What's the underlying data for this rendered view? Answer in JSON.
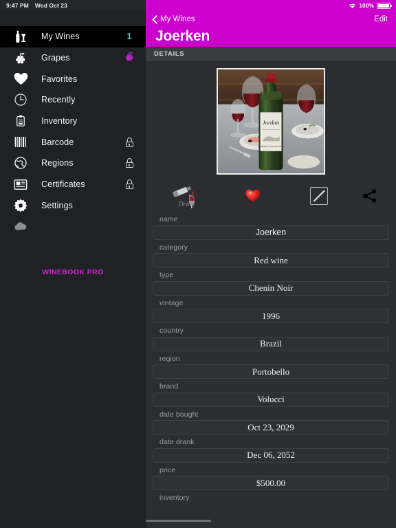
{
  "status_bar": {
    "time": "9:47 PM",
    "date": "Wed Oct 23",
    "battery_percent": "100%",
    "wifi_icon": "wifi-icon",
    "battery_icon": "battery-full-icon"
  },
  "sidebar": {
    "pro_label": "WINEBOOK PRO",
    "items": [
      {
        "label": "My Wines",
        "icon": "wine-bottle-glass-icon",
        "selected": true,
        "badge": "1",
        "lock": false,
        "grapes": false
      },
      {
        "label": "Grapes",
        "icon": "grapes-icon",
        "selected": false,
        "badge": "",
        "lock": false,
        "grapes": true
      },
      {
        "label": "Favorites",
        "icon": "heart-icon",
        "selected": false,
        "badge": "",
        "lock": false,
        "grapes": false
      },
      {
        "label": "Recently",
        "icon": "clock-icon",
        "selected": false,
        "badge": "",
        "lock": false,
        "grapes": false
      },
      {
        "label": "Inventory",
        "icon": "clipboard-icon",
        "selected": false,
        "badge": "",
        "lock": false,
        "grapes": false
      },
      {
        "label": "Barcode",
        "icon": "barcode-icon",
        "selected": false,
        "badge": "",
        "lock": true,
        "grapes": false
      },
      {
        "label": "Regions",
        "icon": "globe-icon",
        "selected": false,
        "badge": "",
        "lock": true,
        "grapes": false
      },
      {
        "label": "Certificates",
        "icon": "certificate-icon",
        "selected": false,
        "badge": "",
        "lock": true,
        "grapes": false
      },
      {
        "label": "Settings",
        "icon": "gear-icon",
        "selected": false,
        "badge": "",
        "lock": false,
        "grapes": false
      },
      {
        "label": "",
        "icon": "cloud-icon",
        "selected": false,
        "badge": "",
        "lock": false,
        "grapes": false
      }
    ]
  },
  "detail": {
    "back_label": "My Wines",
    "edit_label": "Edit",
    "title": "Joerken",
    "section_label": "DETAILS",
    "photo_alt": "wine-bottle-photo",
    "actions": [
      {
        "name": "drink-button",
        "icon": "drink-pour-icon",
        "caption": "Drink"
      },
      {
        "name": "favorite-button",
        "icon": "heart-icon",
        "caption": ""
      },
      {
        "name": "rating-button",
        "icon": "empty-rating-icon",
        "caption": ""
      },
      {
        "name": "share-button",
        "icon": "share-icon",
        "caption": ""
      }
    ],
    "fields": [
      {
        "label": "name",
        "value": "Joerken",
        "serif": false
      },
      {
        "label": "category",
        "value": "Red wine",
        "serif": true
      },
      {
        "label": "type",
        "value": "Chenin Noir",
        "serif": true
      },
      {
        "label": "vintage",
        "value": "1996",
        "serif": true
      },
      {
        "label": "country",
        "value": "Brazil",
        "serif": true
      },
      {
        "label": "region",
        "value": "Portobello",
        "serif": true
      },
      {
        "label": "brand",
        "value": "Volucci",
        "serif": true
      },
      {
        "label": "date bought",
        "value": "Oct 23, 2029",
        "serif": true
      },
      {
        "label": "date drank",
        "value": "Dec 06, 2052",
        "serif": true
      },
      {
        "label": "price",
        "value": "$500.00",
        "serif": true
      },
      {
        "label": "inventory",
        "value": "",
        "serif": true
      }
    ]
  },
  "colors": {
    "accent": "#cc00cc",
    "badge": "#2ee0d0",
    "sidebar_bg": "#1f2124",
    "detail_bg": "#2b2d30"
  }
}
